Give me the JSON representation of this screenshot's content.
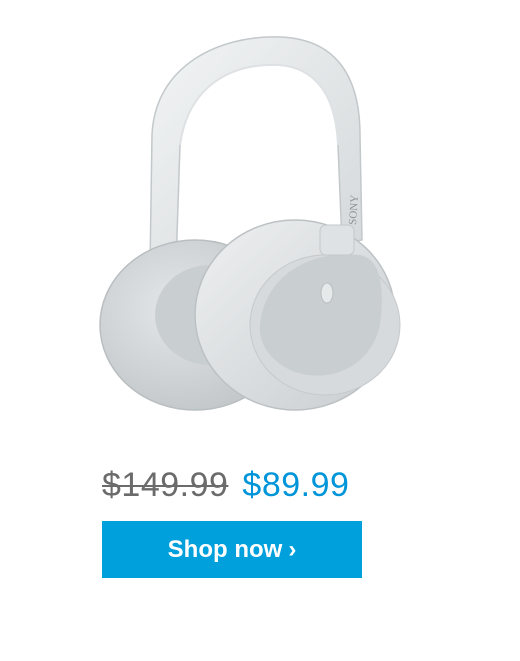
{
  "product": {
    "image_alt": "white over-ear headphones",
    "brand_mark": "SONY",
    "old_price": "$149.99",
    "new_price": "$89.99"
  },
  "cta": {
    "label": "Shop now",
    "chevron": "›"
  },
  "colors": {
    "accent": "#00a0dc",
    "price_new": "#0095d9",
    "price_old": "#6b6b6b"
  }
}
